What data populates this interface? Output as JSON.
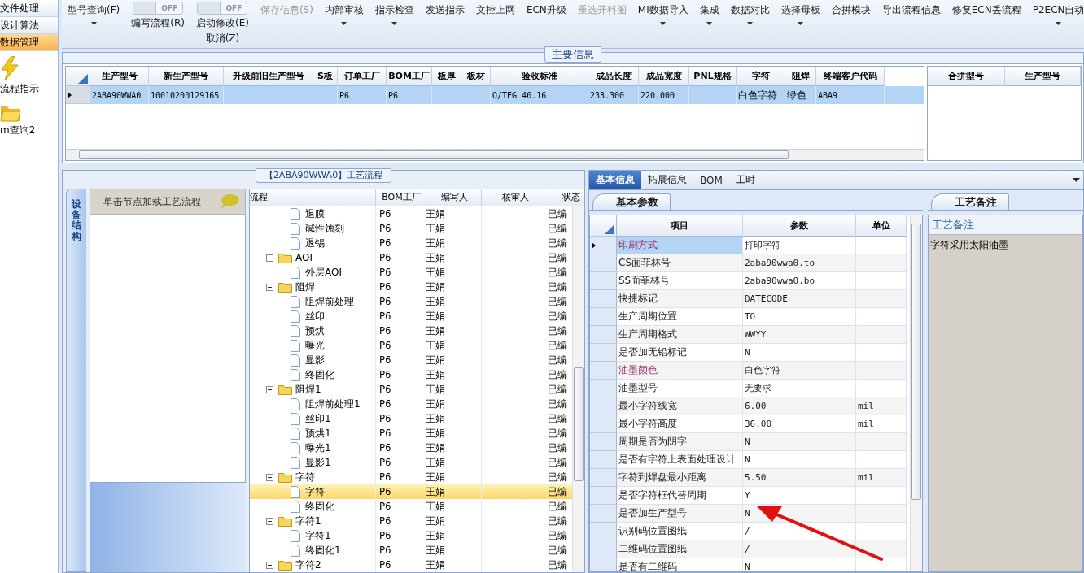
{
  "sidebar": {
    "items": [
      {
        "label": "文件处理",
        "selected": false
      },
      {
        "label": "设计算法",
        "selected": false
      },
      {
        "label": "数据管理",
        "selected": true
      }
    ],
    "shortcuts": [
      {
        "label": "流程指示",
        "kind": "bolt"
      },
      {
        "label": "m查询2",
        "kind": "folder"
      }
    ]
  },
  "toolbar": [
    {
      "kind": "button",
      "label": "型号查询(F)",
      "dropdown": true,
      "disabled": false
    },
    {
      "kind": "toggle",
      "switch": "OFF",
      "on": false,
      "label": "编写流程(R)"
    },
    {
      "kind": "toggle",
      "switch": "OFF",
      "on": false,
      "label": "启动修改(E)",
      "sublabel": "取消(Z)"
    },
    {
      "kind": "button",
      "label": "保存信息(S)",
      "dropdown": false,
      "disabled": true
    },
    {
      "kind": "button",
      "label": "内部审核",
      "dropdown": true,
      "disabled": false
    },
    {
      "kind": "button",
      "label": "指示检查",
      "dropdown": true,
      "disabled": false
    },
    {
      "kind": "button",
      "label": "发送指示",
      "dropdown": false,
      "disabled": false
    },
    {
      "kind": "button",
      "label": "文控上网",
      "dropdown": false,
      "disabled": false
    },
    {
      "kind": "button",
      "label": "ECN升级",
      "dropdown": false,
      "disabled": false
    },
    {
      "kind": "button",
      "label": "重选开料图",
      "dropdown": false,
      "disabled": true
    },
    {
      "kind": "button",
      "label": "MI数据导入",
      "dropdown": true,
      "disabled": false
    },
    {
      "kind": "button",
      "label": "集成",
      "dropdown": true,
      "disabled": false
    },
    {
      "kind": "button",
      "label": "数据对比",
      "dropdown": true,
      "disabled": false
    },
    {
      "kind": "button",
      "label": "选择母板",
      "dropdown": true,
      "disabled": false
    },
    {
      "kind": "button",
      "label": "合拼模块",
      "dropdown": false,
      "disabled": false
    },
    {
      "kind": "button",
      "label": "导出流程信息",
      "dropdown": false,
      "disabled": false
    },
    {
      "kind": "button",
      "label": "修复ECN丢流程",
      "dropdown": false,
      "disabled": false
    },
    {
      "kind": "button",
      "label": "P2ECN自动",
      "dropdown": true,
      "disabled": false
    }
  ],
  "main_info": {
    "title": "主要信息",
    "columns": [
      "生产型号",
      "新生产型号",
      "升级前旧生产型号",
      "S板",
      "订单工厂",
      "BOM工厂",
      "板厚",
      "板材",
      "验收标准",
      "成品长度",
      "成品宽度",
      "PNL规格",
      "字符",
      "阻焊",
      "终端客户代码"
    ],
    "rows": [
      {
        "selected": true,
        "cells": [
          "2ABA90WWA0",
          "10010200129165",
          "",
          "",
          "P6",
          "P6",
          "",
          "",
          "Q/TEG 40.16",
          "233.300",
          "220.000",
          "",
          "白色字符",
          "绿色",
          "ABA9"
        ]
      }
    ],
    "merge_columns": [
      "合拼型号",
      "生产型号"
    ]
  },
  "process": {
    "title": "【2ABA90WWA0】工艺流程",
    "side_tab": "设备结构",
    "hint": "单击节点加载工艺流程",
    "columns": [
      "流程",
      "BOM工厂",
      "编写人",
      "核审人",
      "状态"
    ],
    "tree": [
      {
        "kind": "step",
        "label": "退膜",
        "bom": "P6",
        "writer": "王娟",
        "status": "已编",
        "selected": false
      },
      {
        "kind": "step",
        "label": "碱性蚀刻",
        "bom": "P6",
        "writer": "王娟",
        "status": "已编",
        "selected": false
      },
      {
        "kind": "step",
        "label": "退锡",
        "bom": "P6",
        "writer": "王娟",
        "status": "已编",
        "selected": false
      },
      {
        "kind": "group",
        "label": "AOI",
        "bom": "P6",
        "writer": "王娟",
        "status": "已编",
        "selected": false,
        "expanded": true,
        "children": [
          {
            "kind": "step",
            "label": "外层AOI",
            "bom": "P6",
            "writer": "王娟",
            "status": "已编",
            "selected": false
          }
        ]
      },
      {
        "kind": "group",
        "label": "阻焊",
        "bom": "P6",
        "writer": "王娟",
        "status": "已编",
        "selected": false,
        "expanded": true,
        "children": [
          {
            "kind": "step",
            "label": "阻焊前处理",
            "bom": "P6",
            "writer": "王娟",
            "status": "已编",
            "selected": false
          },
          {
            "kind": "step",
            "label": "丝印",
            "bom": "P6",
            "writer": "王娟",
            "status": "已编",
            "selected": false
          },
          {
            "kind": "step",
            "label": "预烘",
            "bom": "P6",
            "writer": "王娟",
            "status": "已编",
            "selected": false
          },
          {
            "kind": "step",
            "label": "曝光",
            "bom": "P6",
            "writer": "王娟",
            "status": "已编",
            "selected": false
          },
          {
            "kind": "step",
            "label": "显影",
            "bom": "P6",
            "writer": "王娟",
            "status": "已编",
            "selected": false
          },
          {
            "kind": "step",
            "label": "终固化",
            "bom": "P6",
            "writer": "王娟",
            "status": "已编",
            "selected": false
          }
        ]
      },
      {
        "kind": "group",
        "label": "阻焊1",
        "bom": "P6",
        "writer": "王娟",
        "status": "已编",
        "selected": false,
        "expanded": true,
        "children": [
          {
            "kind": "step",
            "label": "阻焊前处理1",
            "bom": "P6",
            "writer": "王娟",
            "status": "已编",
            "selected": false
          },
          {
            "kind": "step",
            "label": "丝印1",
            "bom": "P6",
            "writer": "王娟",
            "status": "已编",
            "selected": false
          },
          {
            "kind": "step",
            "label": "预烘1",
            "bom": "P6",
            "writer": "王娟",
            "status": "已编",
            "selected": false
          },
          {
            "kind": "step",
            "label": "曝光1",
            "bom": "P6",
            "writer": "王娟",
            "status": "已编",
            "selected": false
          },
          {
            "kind": "step",
            "label": "显影1",
            "bom": "P6",
            "writer": "王娟",
            "status": "已编",
            "selected": false
          }
        ]
      },
      {
        "kind": "group",
        "label": "字符",
        "bom": "P6",
        "writer": "王娟",
        "status": "已编",
        "selected": false,
        "expanded": true,
        "children": [
          {
            "kind": "step",
            "label": "字符",
            "bom": "P6",
            "writer": "王娟",
            "status": "已编",
            "selected": true
          },
          {
            "kind": "step",
            "label": "终固化",
            "bom": "P6",
            "writer": "王娟",
            "status": "已编",
            "selected": false
          }
        ]
      },
      {
        "kind": "group",
        "label": "字符1",
        "bom": "P6",
        "writer": "王娟",
        "status": "已编",
        "selected": false,
        "expanded": true,
        "children": [
          {
            "kind": "step",
            "label": "字符1",
            "bom": "P6",
            "writer": "王娟",
            "status": "已编",
            "selected": false
          },
          {
            "kind": "step",
            "label": "终固化1",
            "bom": "P6",
            "writer": "王娟",
            "status": "已编",
            "selected": false
          }
        ]
      },
      {
        "kind": "group",
        "label": "字符2",
        "bom": "P6",
        "writer": "王娟",
        "status": "已编",
        "selected": false,
        "expanded": true
      }
    ]
  },
  "detail_tabs": [
    {
      "label": "基本信息",
      "selected": true
    },
    {
      "label": "拓展信息",
      "selected": false
    },
    {
      "label": "BOM",
      "selected": false
    },
    {
      "label": "工时",
      "selected": false
    }
  ],
  "basic_params": {
    "title": "基本参数",
    "columns": [
      "项目",
      "参数",
      "单位"
    ],
    "rows": [
      {
        "item": "印刷方式",
        "value": "打印字符",
        "unit": "",
        "required": true,
        "selected": true
      },
      {
        "item": "CS面菲林号",
        "value": "2aba90wwa0.to",
        "unit": "",
        "required": false,
        "selected": false
      },
      {
        "item": "SS面菲林号",
        "value": "2aba90wwa0.bo",
        "unit": "",
        "required": false,
        "selected": false
      },
      {
        "item": "快捷标记",
        "value": "DATECODE",
        "unit": "",
        "required": false,
        "selected": false
      },
      {
        "item": "生产周期位置",
        "value": "TO",
        "unit": "",
        "required": false,
        "selected": false
      },
      {
        "item": "生产周期格式",
        "value": "WWYY",
        "unit": "",
        "required": false,
        "selected": false
      },
      {
        "item": "是否加无铅标记",
        "value": "N",
        "unit": "",
        "required": false,
        "selected": false
      },
      {
        "item": "油墨颜色",
        "value": "白色字符",
        "unit": "",
        "required": true,
        "selected": false
      },
      {
        "item": "油墨型号",
        "value": "无要求",
        "unit": "",
        "required": false,
        "selected": false
      },
      {
        "item": "最小字符线宽",
        "value": "6.00",
        "unit": "mil",
        "required": false,
        "selected": false
      },
      {
        "item": "最小字符高度",
        "value": "36.00",
        "unit": "mil",
        "required": false,
        "selected": false
      },
      {
        "item": "周期是否为阴字",
        "value": "N",
        "unit": "",
        "required": false,
        "selected": false
      },
      {
        "item": "是否有字符上表面处理设计",
        "value": "N",
        "unit": "",
        "required": false,
        "selected": false
      },
      {
        "item": "字符到焊盘最小距离",
        "value": "5.50",
        "unit": "mil",
        "required": false,
        "selected": false
      },
      {
        "item": "是否字符框代替周期",
        "value": "Y",
        "unit": "",
        "required": false,
        "selected": false
      },
      {
        "item": "是否加生产型号",
        "value": "N",
        "unit": "",
        "required": false,
        "selected": false
      },
      {
        "item": "识别码位置图纸",
        "value": "/",
        "unit": "",
        "required": false,
        "selected": false
      },
      {
        "item": "二维码位置图纸",
        "value": "/",
        "unit": "",
        "required": false,
        "selected": false
      },
      {
        "item": "是否有二维码",
        "value": "N",
        "unit": "",
        "required": false,
        "selected": false
      }
    ]
  },
  "process_notes": {
    "title": "工艺备注",
    "header": "工艺备注",
    "text": "字符采用太阳油墨"
  }
}
